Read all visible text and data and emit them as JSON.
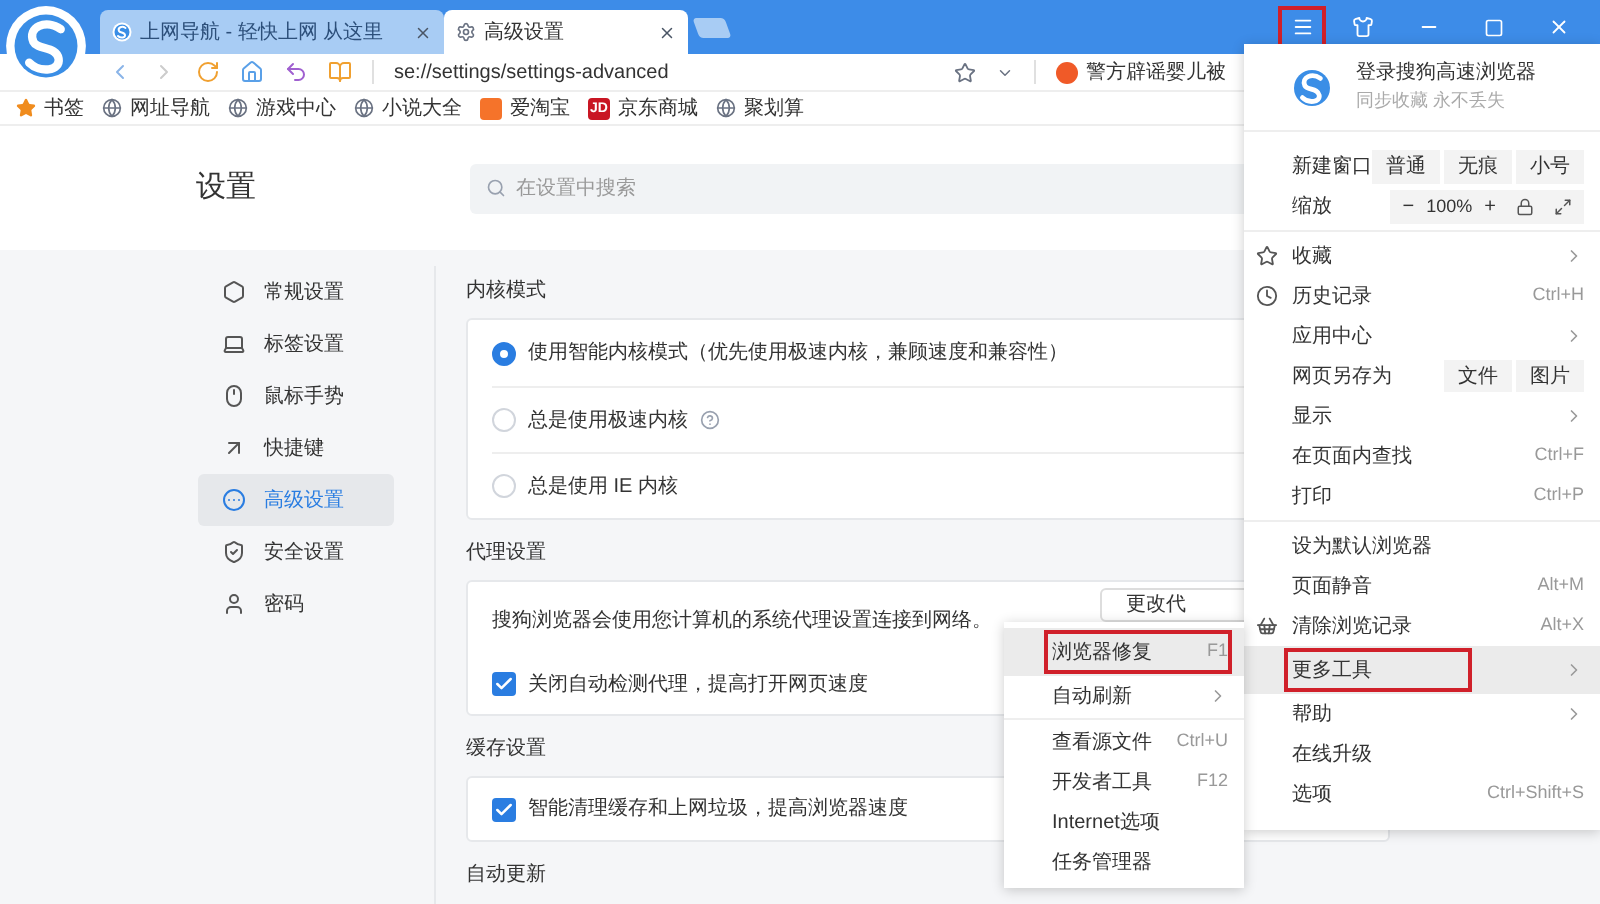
{
  "tabs": [
    {
      "title": "上网导航 - 轻快上网 从这里",
      "selected": false
    },
    {
      "title": "高级设置",
      "selected": true
    }
  ],
  "window_controls": {
    "menu_highlighted": true
  },
  "address": {
    "url": "se://settings/settings-advanced",
    "news": "警方辟谣婴儿被"
  },
  "bookmarks": [
    {
      "label": "书签",
      "kind": "star"
    },
    {
      "label": "网址导航",
      "kind": "globe"
    },
    {
      "label": "游戏中心",
      "kind": "globe"
    },
    {
      "label": "小说大全",
      "kind": "globe"
    },
    {
      "label": "爱淘宝",
      "kind": "taobao"
    },
    {
      "label": "京东商城",
      "kind": "jd",
      "badge": "JD"
    },
    {
      "label": "聚划算",
      "kind": "globe"
    }
  ],
  "settings": {
    "title": "设置",
    "search": {
      "placeholder": "在设置中搜索"
    },
    "nav": [
      {
        "label": "常规设置",
        "kind": "general",
        "selected": false
      },
      {
        "label": "标签设置",
        "kind": "tabs",
        "selected": false
      },
      {
        "label": "鼠标手势",
        "kind": "mouse",
        "selected": false
      },
      {
        "label": "快捷键",
        "kind": "shortcut",
        "selected": false
      },
      {
        "label": "高级设置",
        "kind": "advanced",
        "selected": true
      },
      {
        "label": "安全设置",
        "kind": "security",
        "selected": false
      },
      {
        "label": "密码",
        "kind": "password",
        "selected": false
      }
    ],
    "sections": [
      {
        "heading": "内核模式",
        "kind": "radio",
        "options": [
          {
            "label": "使用智能内核模式（优先使用极速内核，兼顾速度和兼容性）",
            "selected": true,
            "help": false
          },
          {
            "label": "总是使用极速内核",
            "selected": false,
            "help": true
          },
          {
            "label": "总是使用 IE 内核",
            "selected": false,
            "help": false
          }
        ]
      },
      {
        "heading": "代理设置",
        "kind": "proxy",
        "description": "搜狗浏览器会使用您计算机的系统代理设置连接到网络。",
        "button": "更改代",
        "options": [
          {
            "label": "关闭自动检测代理，提高打开网页速度",
            "checked": true
          }
        ]
      },
      {
        "heading": "缓存设置",
        "kind": "checkbox",
        "options": [
          {
            "label": "智能清理缓存和上网垃圾，提高浏览器速度",
            "checked": true
          }
        ]
      },
      {
        "heading": "自动更新",
        "kind": "empty"
      }
    ]
  },
  "main_menu": {
    "account": {
      "title": "登录搜狗高速浏览器",
      "subtitle": "同步收藏 永不丢失"
    },
    "new_window": {
      "label": "新建窗口",
      "buttons": [
        "普通",
        "无痕",
        "小号"
      ]
    },
    "zoom": {
      "label": "缩放",
      "minus": "−",
      "value": "100%",
      "plus": "+"
    },
    "groups": [
      [
        {
          "label": "收藏",
          "kind": "favorites",
          "submenu": true,
          "highlighted": false
        },
        {
          "label": "历史记录",
          "kind": "history",
          "shortcut": "Ctrl+H",
          "submenu": false,
          "highlighted": false
        },
        {
          "label": "应用中心",
          "submenu": true,
          "highlighted": false
        },
        {
          "label": "网页另存为",
          "buttons": [
            "文件",
            "图片"
          ],
          "submenu": false,
          "highlighted": false
        },
        {
          "label": "显示",
          "submenu": true,
          "highlighted": false
        },
        {
          "label": "在页面内查找",
          "shortcut": "Ctrl+F",
          "submenu": false,
          "highlighted": false
        },
        {
          "label": "打印",
          "shortcut": "Ctrl+P",
          "submenu": false,
          "highlighted": false
        }
      ],
      [
        {
          "label": "设为默认浏览器",
          "submenu": false,
          "highlighted": false
        },
        {
          "label": "页面静音",
          "shortcut": "Alt+M",
          "submenu": false,
          "highlighted": false
        },
        {
          "label": "清除浏览记录",
          "kind": "clear",
          "shortcut": "Alt+X",
          "submenu": false,
          "highlighted": false
        },
        {
          "label": "更多工具",
          "submenu": true,
          "highlighted": true
        },
        {
          "label": "帮助",
          "submenu": true,
          "highlighted": false
        },
        {
          "label": "在线升级",
          "submenu": false,
          "highlighted": false
        },
        {
          "label": "选项",
          "shortcut": "Ctrl+Shift+S",
          "submenu": false,
          "highlighted": false
        }
      ]
    ]
  },
  "tools_menu": {
    "groups": [
      [
        {
          "label": "浏览器修复",
          "shortcut": "F1",
          "submenu": false,
          "highlighted": true
        },
        {
          "label": "自动刷新",
          "submenu": true,
          "highlighted": false
        }
      ],
      [
        {
          "label": "查看源文件",
          "shortcut": "Ctrl+U",
          "submenu": false,
          "highlighted": false
        },
        {
          "label": "开发者工具",
          "shortcut": "F12",
          "submenu": false,
          "highlighted": false
        },
        {
          "label": "Internet选项",
          "submenu": false,
          "highlighted": false
        },
        {
          "label": "任务管理器",
          "submenu": false,
          "highlighted": false
        }
      ]
    ]
  }
}
